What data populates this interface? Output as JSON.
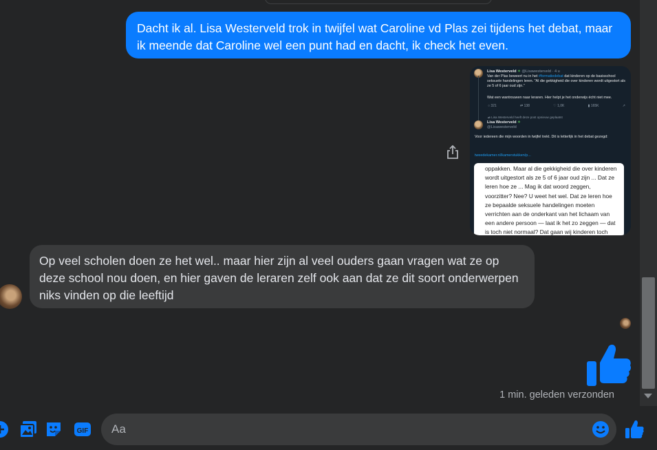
{
  "messages": {
    "outgoing_1": "Dacht ik al. Lisa Westerveld trok in twijfel wat Caroline vd Plas zei tijdens het debat, maar ik meende dat Caroline wel een punt had en dacht, ik check het even.",
    "incoming_1": "Op veel scholen doen ze het wel.. maar hier zijn al veel ouders gaan vragen wat ze op deze school nou doen, en hier gaven de leraren zelf ook aan dat ze dit soort onderwerpen niks vinden op die leeftijd"
  },
  "screenshot": {
    "tweet1": {
      "name": "Lisa Westerveld",
      "handle": "@Lisawesterveld · 4 u",
      "text_before_link": "Van der Plas beweert nu in het ",
      "hashtag": "#formatiedebat",
      "text_after_link": " dat kinderen op de basisschool seksuele handelingen leren. \"Al die gekkigheid die over kinderen wordt uitgestort als ze 5 of 6 jaar oud zijn.\"",
      "text_2": "Wat een wantrouwen naar leraren. Hier helpt je het onderwijs écht niet mee.",
      "stats": [
        "321",
        "138",
        "1,0K",
        "165K"
      ]
    },
    "retweet_note": "Lisa Westerveld heeft deze post opnieuw geplaatst",
    "tweet2": {
      "name": "Lisa Westerveld",
      "handle": "@Lisawesterveld",
      "text": "Voor iedereen die mijn woorden in twijfel trekt. Dit is letterlijk in het debat gezegd:",
      "link": "tweedekamer.nl/kamerstukken/p..."
    },
    "quote": "oppakken. Maar al die gekkigheid die over kinderen wordt uitgestort als ze 5 of 6 jaar oud zijn ... Dat ze leren hoe ze ... Mag ik dat woord zeggen, voorzitter? Nee? U weet het wel. Dat ze leren hoe ze bepaalde seksuele handelingen moeten verrichten aan de onderkant van het lichaam van een andere persoon — laat ik het zo zeggen — dat is toch niet normaal? Dat gaan wij kinderen toch niet vertellen? Alsjeblieft. Dat is hoe ik erin sta."
  },
  "status": {
    "sent": "1 min. geleden verzonden"
  },
  "composer": {
    "placeholder": "Aa"
  },
  "icons": {
    "share": "share-icon",
    "like": "thumbs-up-icon",
    "emoji": "emoji-icon",
    "photo": "photo-icon",
    "sticker": "sticker-icon",
    "gif": "gif-icon",
    "more": "plus-icon"
  },
  "colors": {
    "background": "#242526",
    "outgoing_bubble": "#0a7cff",
    "incoming_bubble": "#3a3b3c",
    "accent": "#0a7cff"
  }
}
